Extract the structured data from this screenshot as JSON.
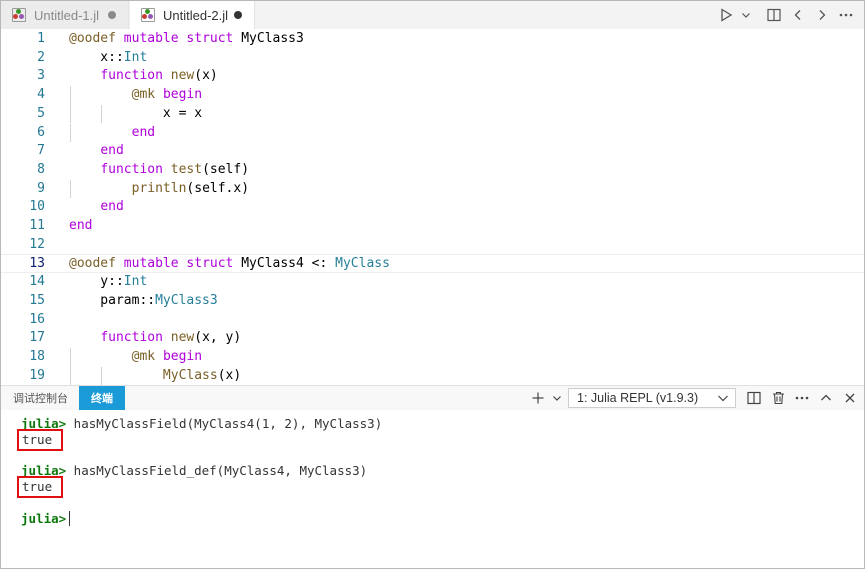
{
  "tabs": [
    {
      "name": "Untitled-1.jl",
      "active": false
    },
    {
      "name": "Untitled-2.jl",
      "active": true
    }
  ],
  "editor_actions": [
    "run-icon",
    "chevron-down-icon",
    "split-editor-icon",
    "back-icon",
    "forward-icon",
    "more-icon"
  ],
  "editor": {
    "current_line": 13,
    "lines": [
      {
        "n": "1",
        "tokens": [
          [
            "mac",
            "@oodef"
          ],
          [
            "pl",
            " "
          ],
          [
            "kw",
            "mutable"
          ],
          [
            "pl",
            " "
          ],
          [
            "kw",
            "struct"
          ],
          [
            "pl",
            " MyClass3"
          ]
        ]
      },
      {
        "n": "2",
        "tokens": [
          [
            "pl",
            "    x::"
          ],
          [
            "typ",
            "Int"
          ]
        ]
      },
      {
        "n": "3",
        "tokens": [
          [
            "pl",
            "    "
          ],
          [
            "kw",
            "function"
          ],
          [
            "pl",
            " "
          ],
          [
            "fn",
            "new"
          ],
          [
            "pl",
            "(x)"
          ]
        ]
      },
      {
        "n": "4",
        "tokens": [
          [
            "pl",
            "        "
          ],
          [
            "mac",
            "@mk"
          ],
          [
            "pl",
            " "
          ],
          [
            "kw",
            "begin"
          ]
        ]
      },
      {
        "n": "5",
        "tokens": [
          [
            "pl",
            "            x = x"
          ]
        ]
      },
      {
        "n": "6",
        "tokens": [
          [
            "pl",
            "        "
          ],
          [
            "kw",
            "end"
          ]
        ]
      },
      {
        "n": "7",
        "tokens": [
          [
            "pl",
            "    "
          ],
          [
            "kw",
            "end"
          ]
        ]
      },
      {
        "n": "8",
        "tokens": [
          [
            "pl",
            "    "
          ],
          [
            "kw",
            "function"
          ],
          [
            "pl",
            " "
          ],
          [
            "fn",
            "test"
          ],
          [
            "pl",
            "(self)"
          ]
        ]
      },
      {
        "n": "9",
        "tokens": [
          [
            "pl",
            "        "
          ],
          [
            "fn",
            "println"
          ],
          [
            "pl",
            "(self.x)"
          ]
        ]
      },
      {
        "n": "10",
        "tokens": [
          [
            "pl",
            "    "
          ],
          [
            "kw",
            "end"
          ]
        ]
      },
      {
        "n": "11",
        "tokens": [
          [
            "kw",
            "end"
          ]
        ]
      },
      {
        "n": "12",
        "tokens": []
      },
      {
        "n": "13",
        "tokens": [
          [
            "mac",
            "@oodef"
          ],
          [
            "pl",
            " "
          ],
          [
            "kw",
            "mutable"
          ],
          [
            "pl",
            " "
          ],
          [
            "kw",
            "struct"
          ],
          [
            "pl",
            " MyClass4 <: "
          ],
          [
            "typ",
            "MyClass"
          ]
        ]
      },
      {
        "n": "14",
        "tokens": [
          [
            "pl",
            "    y::"
          ],
          [
            "typ",
            "Int"
          ]
        ]
      },
      {
        "n": "15",
        "tokens": [
          [
            "pl",
            "    param::"
          ],
          [
            "typ",
            "MyClass3"
          ]
        ]
      },
      {
        "n": "16",
        "tokens": []
      },
      {
        "n": "17",
        "tokens": [
          [
            "pl",
            "    "
          ],
          [
            "kw",
            "function"
          ],
          [
            "pl",
            " "
          ],
          [
            "fn",
            "new"
          ],
          [
            "pl",
            "(x, y)"
          ]
        ]
      },
      {
        "n": "18",
        "tokens": [
          [
            "pl",
            "        "
          ],
          [
            "mac",
            "@mk"
          ],
          [
            "pl",
            " "
          ],
          [
            "kw",
            "begin"
          ]
        ]
      },
      {
        "n": "19",
        "tokens": [
          [
            "pl",
            "            "
          ],
          [
            "fn",
            "MyClass"
          ],
          [
            "pl",
            "(x)"
          ]
        ]
      }
    ]
  },
  "panel": {
    "tabs": {
      "debug": "调试控制台",
      "terminal": "终端"
    },
    "repl_select": "1: Julia REPL (v1.9.3)",
    "terminal": [
      {
        "prompt": "julia>",
        "cmd": " hasMyClassField(MyClass4(1, 2), MyClass3)",
        "output": "true"
      },
      {
        "prompt": "julia>",
        "cmd": " hasMyClassField_def(MyClass4, MyClass3)",
        "output": "true"
      },
      {
        "prompt": "julia>",
        "cmd": "",
        "output": ""
      }
    ]
  },
  "colors": {
    "accent_tab": "#1a9bd7",
    "prompt": "#0d7a0d",
    "highlight_box": "#e01010"
  }
}
